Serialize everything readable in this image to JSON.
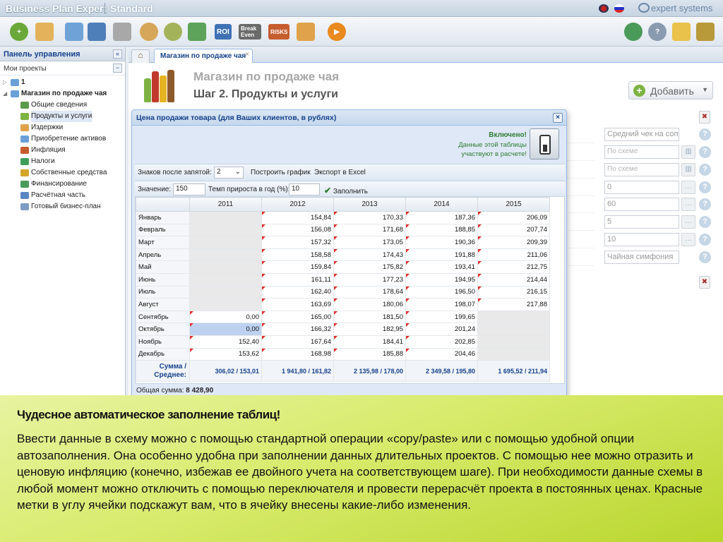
{
  "app": {
    "title": "Business Plan Expert",
    "edition": "Standard",
    "brand": "expert systems"
  },
  "toolbar": {
    "roi_label": "ROI",
    "break_even_label": "Break Even",
    "risks_label": "RISKS"
  },
  "left_panel": {
    "title": "Панель управления",
    "collapse": "«",
    "projects_label": "Мои проекты",
    "projects_toggle": "−",
    "tree": [
      {
        "label": "1",
        "level": 0
      },
      {
        "label": "Магазин по продаже чая",
        "level": 0
      },
      {
        "label": "Общие сведения",
        "level": 1
      },
      {
        "label": "Продукты и услуги",
        "level": 1
      },
      {
        "label": "Издержки",
        "level": 1
      },
      {
        "label": "Приобретение активов",
        "level": 1
      },
      {
        "label": "Инфляция",
        "level": 1
      },
      {
        "label": "Налоги",
        "level": 1
      },
      {
        "label": "Собственные средства",
        "level": 1
      },
      {
        "label": "Финансирование",
        "level": 1
      },
      {
        "label": "Расчётная часть",
        "level": 1
      },
      {
        "label": "Готовый бизнес-план",
        "level": 1
      }
    ]
  },
  "tabs": {
    "active": "Магазин по продаже чая",
    "close": "×"
  },
  "main": {
    "title": "Магазин по продаже чая",
    "subtitle": "Шаг 2. Продукты и услуги",
    "add_button": "Добавить",
    "right_fields": [
      "Средний чек на сопутст",
      "По схеме",
      "По схеме",
      "0",
      "60",
      "5",
      "10",
      "Чайная симфония"
    ]
  },
  "dialog": {
    "title": "Цена продажи товара (для Ваших клиентов, в рублях)",
    "enabled_title": "Включено!",
    "enabled_text": "Данные этой таблицы участвуют в расчете!",
    "decimals_label": "Знаков после запятой:",
    "decimals_value": "2",
    "build_chart": "Построить график",
    "export_excel": "Экспорт в Excel",
    "value_label": "Значение:",
    "value": "150",
    "growth_label": "Темп прироста в  год (%):",
    "growth_value": "10",
    "fill_label": "Заполнить",
    "years": [
      "2011",
      "2012",
      "2013",
      "2014",
      "2015"
    ],
    "rows": [
      {
        "month": "Январь",
        "values": [
          "",
          "154,84",
          "170,33",
          "187,36",
          "206,09"
        ]
      },
      {
        "month": "Февраль",
        "values": [
          "",
          "156,08",
          "171,68",
          "188,85",
          "207,74"
        ]
      },
      {
        "month": "Март",
        "values": [
          "",
          "157,32",
          "173,05",
          "190,36",
          "209,39"
        ]
      },
      {
        "month": "Апрель",
        "values": [
          "",
          "158,58",
          "174,43",
          "191,88",
          "211,06"
        ]
      },
      {
        "month": "Май",
        "values": [
          "",
          "159,84",
          "175,82",
          "193,41",
          "212,75"
        ]
      },
      {
        "month": "Июнь",
        "values": [
          "",
          "161,11",
          "177,23",
          "194,95",
          "214,44"
        ]
      },
      {
        "month": "Июль",
        "values": [
          "",
          "162,40",
          "178,64",
          "196,50",
          "216,15"
        ]
      },
      {
        "month": "Август",
        "values": [
          "",
          "163,69",
          "180,06",
          "198,07",
          "217,88"
        ]
      },
      {
        "month": "Сентябрь",
        "values": [
          "0,00",
          "165,00",
          "181,50",
          "199,65",
          ""
        ]
      },
      {
        "month": "Октябрь",
        "values": [
          "0,00",
          "166,32",
          "182,95",
          "201,24",
          ""
        ]
      },
      {
        "month": "Ноябрь",
        "values": [
          "152,40",
          "167,64",
          "184,41",
          "202,85",
          ""
        ]
      },
      {
        "month": "Декабрь",
        "values": [
          "153,62",
          "168,98",
          "185,88",
          "204,46",
          ""
        ]
      }
    ],
    "sum_label_1": "Сумма /",
    "sum_label_2": "Среднее:",
    "sums": [
      "306,02 / 153,01",
      "1 941,80 / 161,82",
      "2 135,98 / 178,00",
      "2 349,58 / 195,80",
      "1 695,52 / 211,94"
    ],
    "total_label": "Общая сумма:",
    "total_value": "8 428,90"
  },
  "overlay": {
    "title": "Чудесное автоматическое заполнение таблиц!",
    "body": "Ввести данные в схему можно с помощью стандартной операции «copy/paste» или с помощью удобной опции автозаполнения. Она особенно удобна при заполнении данных длительных проектов. С помощью нее можно отразить и  ценовую инфляцию (конечно, избежав ее двойного учета на соответствующем шаге). При необходимости данные схемы в любой момент можно отключить с помощью переключателя и провести перерасчёт проекта в постоянных ценах. Красные метки в углу ячейки подскажут вам, что в ячейку внесены какие-либо изменения."
  }
}
